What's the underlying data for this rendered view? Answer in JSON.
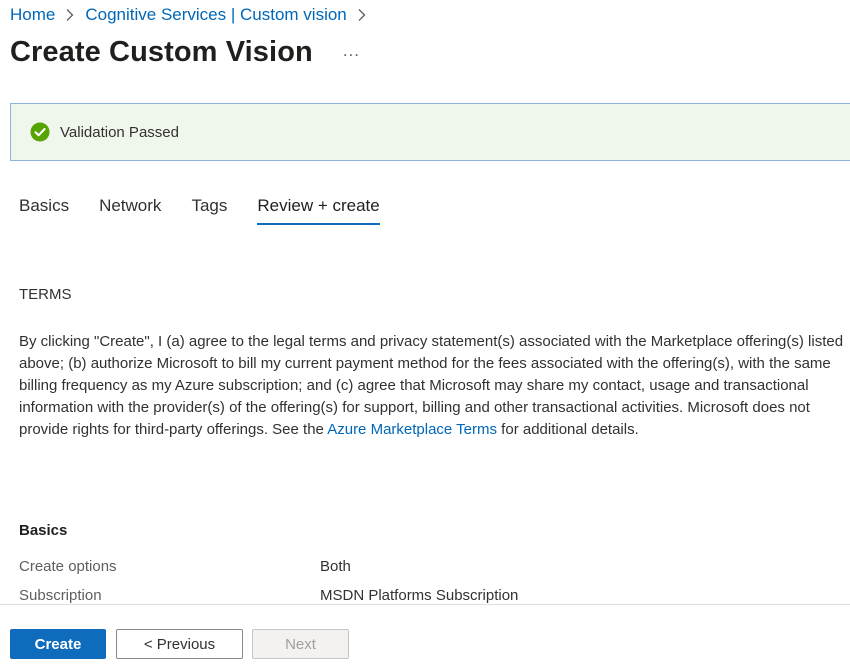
{
  "breadcrumb": {
    "items": [
      "Home",
      "Cognitive Services | Custom vision"
    ]
  },
  "header": {
    "title": "Create Custom Vision",
    "more_label": "..."
  },
  "banner": {
    "text": "Validation Passed",
    "status_color": "#57a300",
    "icon": "checkmark-circle-icon"
  },
  "tabs": [
    {
      "label": "Basics",
      "active": false
    },
    {
      "label": "Network",
      "active": false
    },
    {
      "label": "Tags",
      "active": false
    },
    {
      "label": "Review + create",
      "active": true
    }
  ],
  "terms": {
    "heading": "TERMS",
    "text_before_link": "By clicking \"Create\", I (a) agree to the legal terms and privacy statement(s) associated with the Marketplace offering(s) listed above; (b) authorize Microsoft to bill my current payment method for the fees associated with the offering(s), with the same billing frequency as my Azure subscription; and (c) agree that Microsoft may share my contact, usage and transactional information with the provider(s) of the offering(s) for support, billing and other transactional activities. Microsoft does not provide rights for third-party offerings. See the ",
    "link_text": "Azure Marketplace Terms",
    "text_after_link": " for additional details."
  },
  "basics": {
    "heading": "Basics",
    "rows": [
      {
        "label": "Create options",
        "value": "Both"
      },
      {
        "label": "Subscription",
        "value": "MSDN Platforms Subscription"
      }
    ]
  },
  "footer": {
    "create_label": "Create",
    "previous_label": "< Previous",
    "next_label": "Next"
  },
  "colors": {
    "accent": "#0f6cbd",
    "link": "#0067b8",
    "banner_bg": "#eff6ec"
  }
}
